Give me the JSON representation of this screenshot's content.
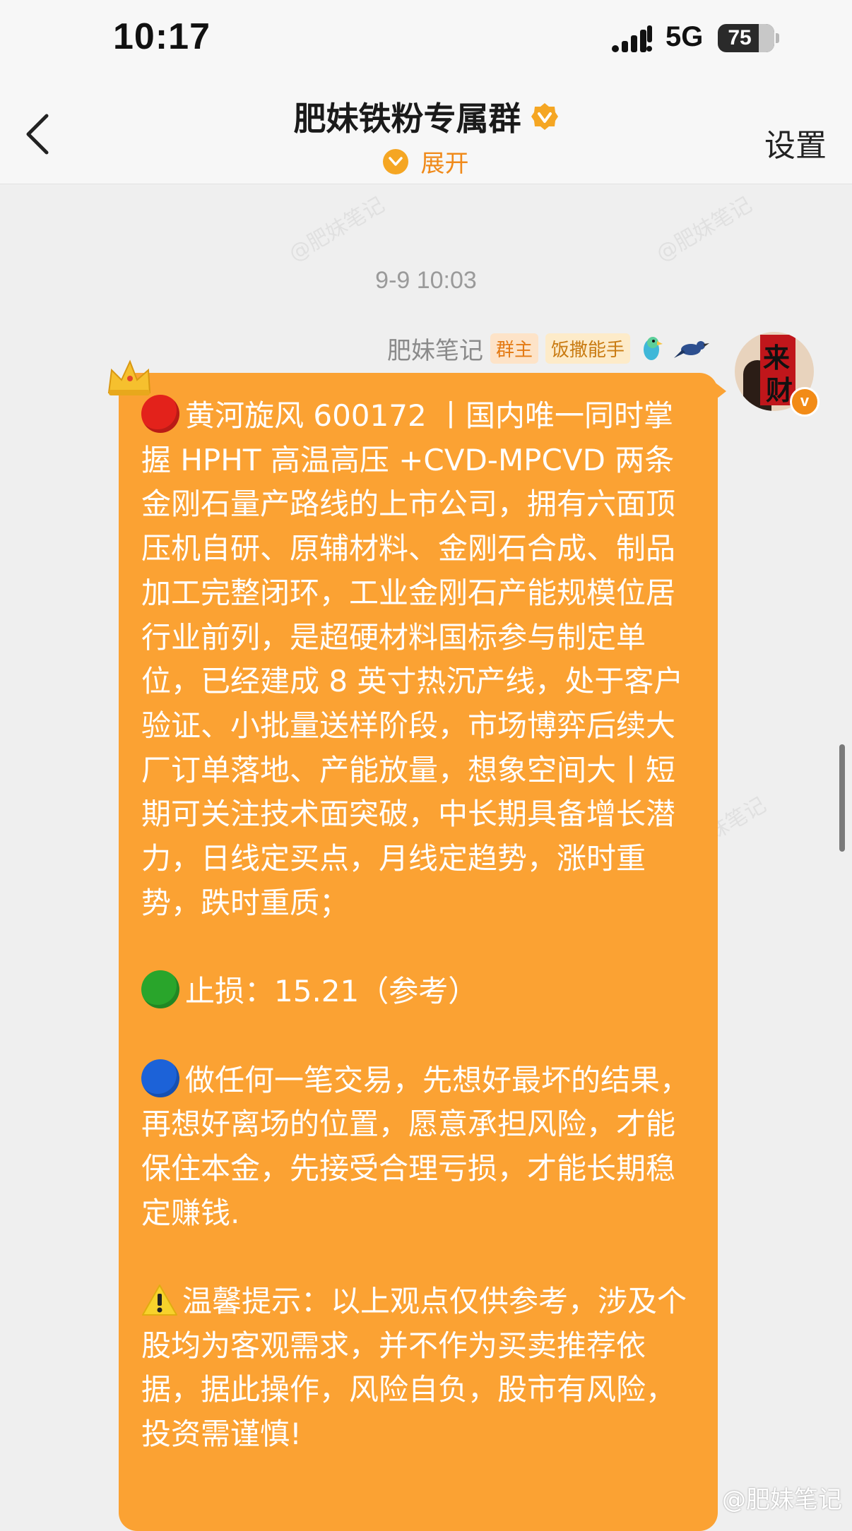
{
  "status_bar": {
    "time": "10:17",
    "network": "5G",
    "battery": "75",
    "battery_level": 0.75
  },
  "header": {
    "back_icon": "chevron-left-icon",
    "title": "肥妹铁粉专属群",
    "expand_label": "展开",
    "settings_label": "设置"
  },
  "chat": {
    "timestamp": "9-9 10:03",
    "message": {
      "sender": "肥妹笔记",
      "badges": [
        "群主",
        "饭撒能手"
      ],
      "avatar_text": [
        "来",
        "财"
      ],
      "paragraphs": [
        "黄河旋风 600172 丨国内唯一同时掌握 HPHT 高温高压 +CVD-MPCVD 两条金刚石量产路线的上市公司，拥有六面顶压机自研、原辅材料、金刚石合成、制品加工完整闭环，工业金刚石产能规模位居行业前列，是超硬材料国标参与制定单位，已经建成 8 英寸热沉产线，处于客户验证、小批量送样阶段，市场博弈后续大厂订单落地、产能放量，想象空间大丨短期可关注技术面突破，中长期具备增长潜力，日线定买点，月线定趋势，涨时重势，跌时重质；",
        "止损：15.21（参考）",
        "做任何一笔交易，先想好最坏的结果，再想好离场的位置，愿意承担风险，才能保住本金，先接受合理亏损，才能长期稳定赚钱.",
        "温馨提示：以上观点仅供参考，涉及个股均为客观需求，并不作为买卖推荐依据，据此操作，风险自负，股市有风险，投资需谨慎!"
      ]
    }
  },
  "watermark": "@肥妹笔记",
  "colors": {
    "bubble": "#fba233",
    "accent": "#f08a1a",
    "background": "#efefef"
  }
}
